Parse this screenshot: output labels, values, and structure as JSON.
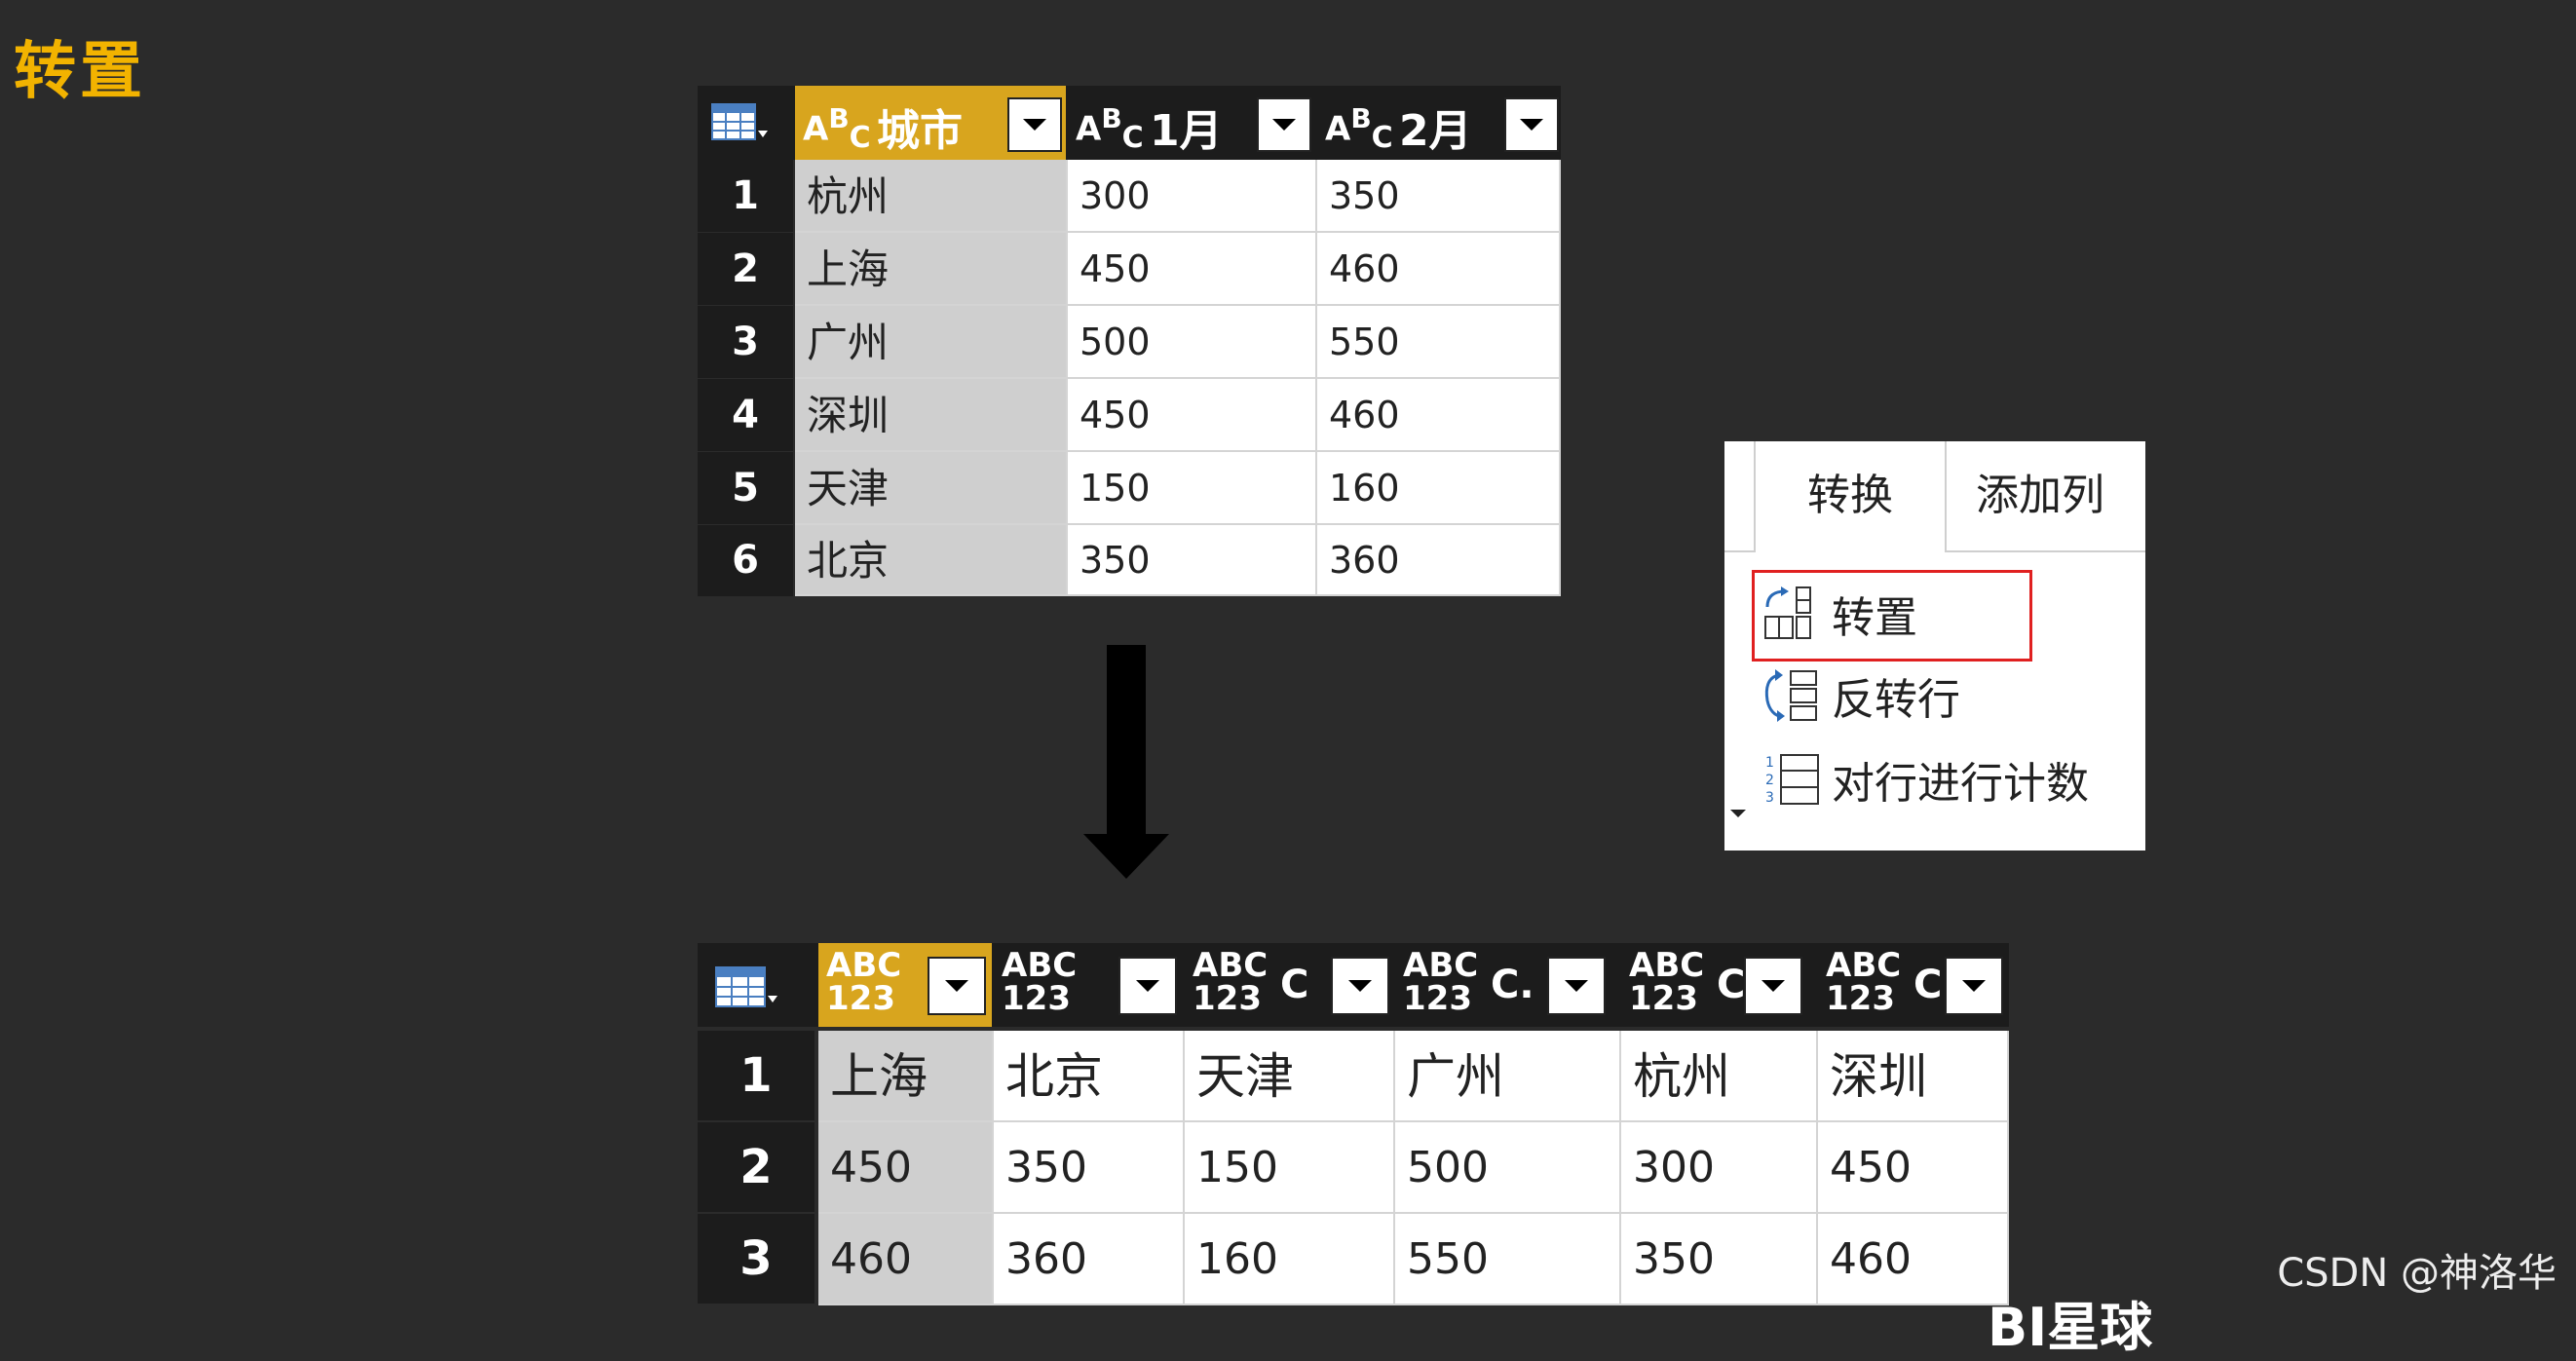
{
  "page_title": "转置",
  "source_table": {
    "columns": [
      {
        "type_icon": "ABC",
        "name": "城市",
        "selected": true
      },
      {
        "type_icon": "ABC",
        "name": "1月",
        "selected": false
      },
      {
        "type_icon": "ABC",
        "name": "2月",
        "selected": false
      }
    ],
    "row_numbers": [
      "1",
      "2",
      "3",
      "4",
      "5",
      "6"
    ],
    "rows": [
      [
        "杭州",
        "300",
        "350"
      ],
      [
        "上海",
        "450",
        "460"
      ],
      [
        "广州",
        "500",
        "550"
      ],
      [
        "深圳",
        "450",
        "460"
      ],
      [
        "天津",
        "150",
        "160"
      ],
      [
        "北京",
        "350",
        "360"
      ]
    ]
  },
  "result_table": {
    "columns": [
      {
        "type_top": "ABC",
        "type_bottom": "123",
        "name": "",
        "selected": true
      },
      {
        "type_top": "ABC",
        "type_bottom": "123",
        "name": "",
        "selected": false
      },
      {
        "type_top": "ABC",
        "type_bottom": "123",
        "name": "C",
        "selected": false
      },
      {
        "type_top": "ABC",
        "type_bottom": "123",
        "name": "C.",
        "selected": false
      },
      {
        "type_top": "ABC",
        "type_bottom": "123",
        "name": "C",
        "selected": false
      },
      {
        "type_top": "ABC",
        "type_bottom": "123",
        "name": "C",
        "selected": false
      }
    ],
    "row_numbers": [
      "1",
      "2",
      "3"
    ],
    "rows": [
      [
        "上海",
        "北京",
        "天津",
        "广州",
        "杭州",
        "深圳"
      ],
      [
        "450",
        "350",
        "150",
        "500",
        "300",
        "450"
      ],
      [
        "460",
        "360",
        "160",
        "550",
        "350",
        "460"
      ]
    ]
  },
  "ribbon": {
    "tabs": [
      "转换",
      "添加列"
    ],
    "active_tab": "转换",
    "commands": [
      {
        "label": "转置",
        "icon": "transpose-icon",
        "highlighted": true
      },
      {
        "label": "反转行",
        "icon": "reverse-rows-icon",
        "highlighted": false
      },
      {
        "label": "对行进行计数",
        "icon": "count-rows-icon",
        "highlighted": false
      }
    ]
  },
  "watermark": "CSDN @神洛华",
  "footer_partial": "BI星球",
  "colors": {
    "background": "#2b2b2b",
    "title": "#f2b300",
    "selected_header": "#d8a51e",
    "highlight_border": "#e02020"
  }
}
